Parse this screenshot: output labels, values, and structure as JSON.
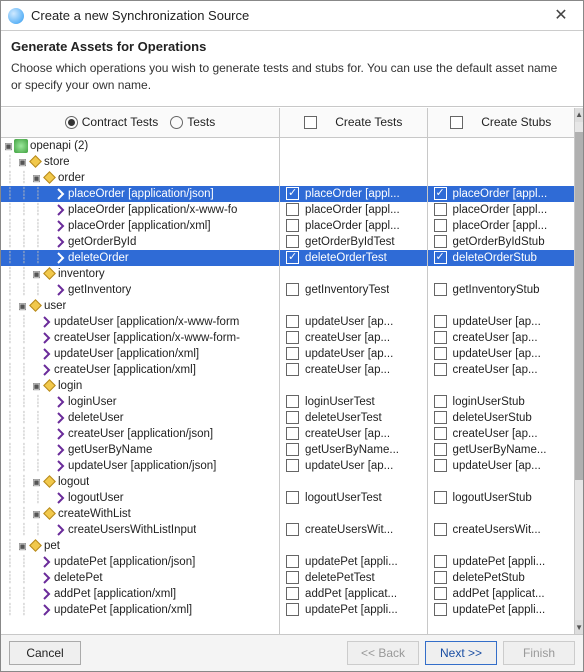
{
  "window": {
    "title": "Create a new Synchronization Source"
  },
  "header": {
    "title": "Generate Assets for Operations",
    "desc": "Choose which operations you wish to generate tests and stubs for. You can use the default asset name or specify your own name."
  },
  "columns": {
    "radios": {
      "contract": "Contract Tests",
      "tests": "Tests"
    },
    "tests": "Create Tests",
    "stubs": "Create Stubs"
  },
  "rows": [
    {
      "t": "root",
      "ind": 0,
      "tw": "-",
      "label": "openapi (2)"
    },
    {
      "t": "pkg",
      "ind": 1,
      "tw": "-",
      "label": "store"
    },
    {
      "t": "pkg",
      "ind": 2,
      "tw": "-",
      "label": "order"
    },
    {
      "t": "op",
      "ind": 3,
      "label": "placeOrder [application/json]",
      "sel": true,
      "tests": {
        "cb": true,
        "label": "placeOrder [appl..."
      },
      "stubs": {
        "cb": true,
        "label": "placeOrder [appl..."
      }
    },
    {
      "t": "op",
      "ind": 3,
      "label": "placeOrder [application/x-www-fo",
      "tests": {
        "cb": false,
        "label": "placeOrder [appl..."
      },
      "stubs": {
        "cb": false,
        "label": "placeOrder [appl..."
      }
    },
    {
      "t": "op",
      "ind": 3,
      "label": "placeOrder [application/xml]",
      "tests": {
        "cb": false,
        "label": "placeOrder [appl..."
      },
      "stubs": {
        "cb": false,
        "label": "placeOrder [appl..."
      }
    },
    {
      "t": "op",
      "ind": 3,
      "label": "getOrderById",
      "tests": {
        "cb": false,
        "label": "getOrderByIdTest"
      },
      "stubs": {
        "cb": false,
        "label": "getOrderByIdStub"
      }
    },
    {
      "t": "op",
      "ind": 3,
      "label": "deleteOrder",
      "sel": true,
      "tests": {
        "cb": true,
        "label": "deleteOrderTest"
      },
      "stubs": {
        "cb": true,
        "label": "deleteOrderStub"
      }
    },
    {
      "t": "pkg",
      "ind": 2,
      "tw": "-",
      "label": "inventory"
    },
    {
      "t": "op",
      "ind": 3,
      "label": "getInventory",
      "tests": {
        "cb": false,
        "label": "getInventoryTest"
      },
      "stubs": {
        "cb": false,
        "label": "getInventoryStub"
      }
    },
    {
      "t": "pkg",
      "ind": 1,
      "tw": "-",
      "label": "user"
    },
    {
      "t": "op",
      "ind": 2,
      "label": "updateUser [application/x-www-form",
      "tests": {
        "cb": false,
        "label": "updateUser [ap..."
      },
      "stubs": {
        "cb": false,
        "label": "updateUser [ap..."
      }
    },
    {
      "t": "op",
      "ind": 2,
      "label": "createUser [application/x-www-form-",
      "tests": {
        "cb": false,
        "label": "createUser [ap..."
      },
      "stubs": {
        "cb": false,
        "label": "createUser [ap..."
      }
    },
    {
      "t": "op",
      "ind": 2,
      "label": "updateUser [application/xml]",
      "tests": {
        "cb": false,
        "label": "updateUser [ap..."
      },
      "stubs": {
        "cb": false,
        "label": "updateUser [ap..."
      }
    },
    {
      "t": "op",
      "ind": 2,
      "label": "createUser [application/xml]",
      "tests": {
        "cb": false,
        "label": "createUser [ap..."
      },
      "stubs": {
        "cb": false,
        "label": "createUser [ap..."
      }
    },
    {
      "t": "pkg",
      "ind": 2,
      "tw": "-",
      "label": "login"
    },
    {
      "t": "op",
      "ind": 3,
      "label": "loginUser",
      "tests": {
        "cb": false,
        "label": "loginUserTest"
      },
      "stubs": {
        "cb": false,
        "label": "loginUserStub"
      }
    },
    {
      "t": "op",
      "ind": 3,
      "label": "deleteUser",
      "tests": {
        "cb": false,
        "label": "deleteUserTest"
      },
      "stubs": {
        "cb": false,
        "label": "deleteUserStub"
      }
    },
    {
      "t": "op",
      "ind": 3,
      "label": "createUser [application/json]",
      "tests": {
        "cb": false,
        "label": "createUser [ap..."
      },
      "stubs": {
        "cb": false,
        "label": "createUser [ap..."
      }
    },
    {
      "t": "op",
      "ind": 3,
      "label": "getUserByName",
      "tests": {
        "cb": false,
        "label": "getUserByName..."
      },
      "stubs": {
        "cb": false,
        "label": "getUserByName..."
      }
    },
    {
      "t": "op",
      "ind": 3,
      "label": "updateUser [application/json]",
      "tests": {
        "cb": false,
        "label": "updateUser [ap..."
      },
      "stubs": {
        "cb": false,
        "label": "updateUser [ap..."
      }
    },
    {
      "t": "pkg",
      "ind": 2,
      "tw": "-",
      "label": "logout"
    },
    {
      "t": "op",
      "ind": 3,
      "label": "logoutUser",
      "tests": {
        "cb": false,
        "label": "logoutUserTest"
      },
      "stubs": {
        "cb": false,
        "label": "logoutUserStub"
      }
    },
    {
      "t": "pkg",
      "ind": 2,
      "tw": "-",
      "label": "createWithList"
    },
    {
      "t": "op",
      "ind": 3,
      "label": "createUsersWithListInput",
      "tests": {
        "cb": false,
        "label": "createUsersWit..."
      },
      "stubs": {
        "cb": false,
        "label": "createUsersWit..."
      }
    },
    {
      "t": "pkg",
      "ind": 1,
      "tw": "-",
      "label": "pet"
    },
    {
      "t": "op",
      "ind": 2,
      "label": "updatePet [application/json]",
      "tests": {
        "cb": false,
        "label": "updatePet [appli..."
      },
      "stubs": {
        "cb": false,
        "label": "updatePet [appli..."
      }
    },
    {
      "t": "op",
      "ind": 2,
      "label": "deletePet",
      "tests": {
        "cb": false,
        "label": "deletePetTest"
      },
      "stubs": {
        "cb": false,
        "label": "deletePetStub"
      }
    },
    {
      "t": "op",
      "ind": 2,
      "label": "addPet [application/xml]",
      "tests": {
        "cb": false,
        "label": "addPet [applicat..."
      },
      "stubs": {
        "cb": false,
        "label": "addPet [applicat..."
      }
    },
    {
      "t": "op",
      "ind": 2,
      "label": "updatePet [application/xml]",
      "tests": {
        "cb": false,
        "label": "updatePet [appli..."
      },
      "stubs": {
        "cb": false,
        "label": "updatePet [appli..."
      }
    }
  ],
  "footer": {
    "cancel": "Cancel",
    "back": "<< Back",
    "next": "Next >>",
    "finish": "Finish"
  }
}
